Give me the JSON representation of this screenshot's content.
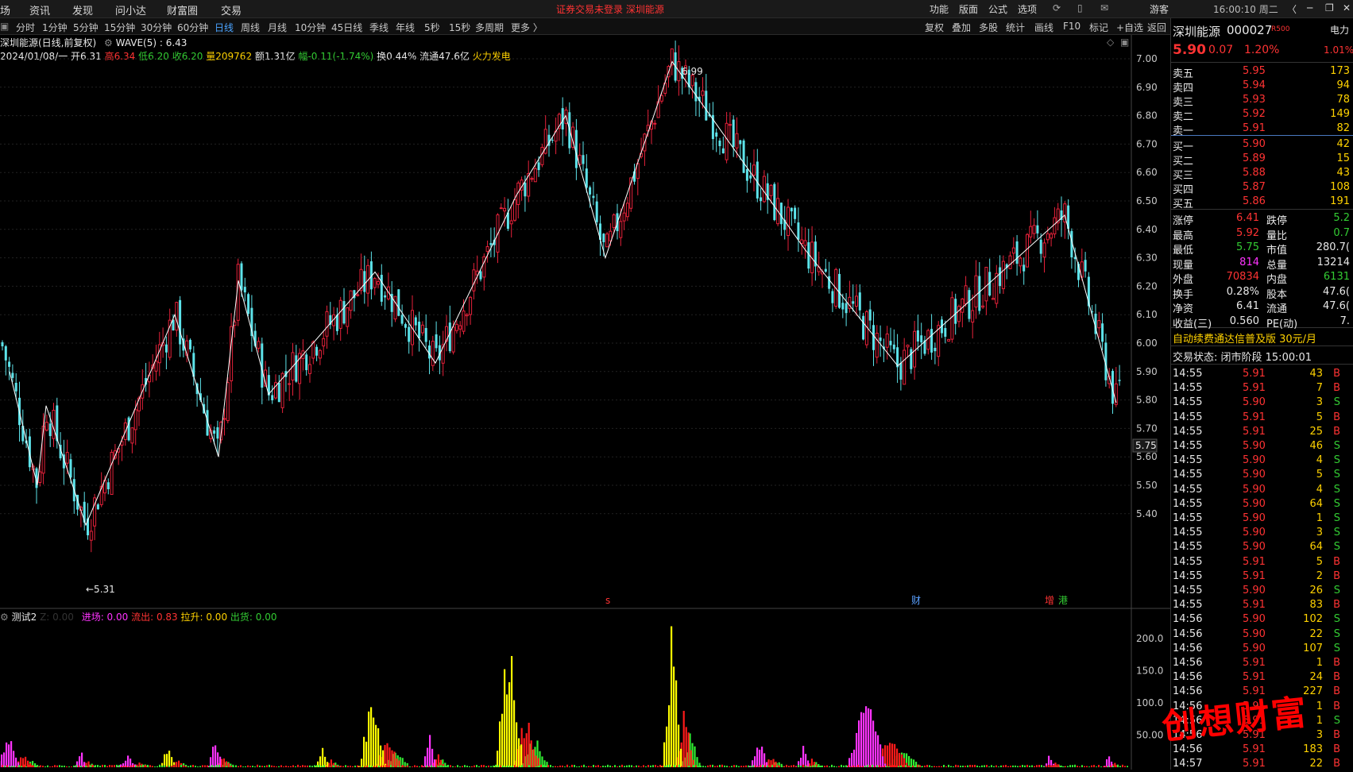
{
  "top_menu": {
    "items": [
      "场",
      "资讯",
      "发现",
      "问小达",
      "财富圈",
      "交易"
    ],
    "notice": "证券交易未登录   深圳能源",
    "right_items": [
      "功能",
      "版面",
      "公式",
      "选项"
    ],
    "guest": "游客",
    "clock": "16:00:10 周二"
  },
  "toolbar": {
    "periods": [
      "分时",
      "1分钟",
      "5分钟",
      "15分钟",
      "30分钟",
      "60分钟",
      "日线",
      "周线",
      "月线",
      "10分钟",
      "45日线",
      "季线",
      "年线",
      "5秒",
      "15秒",
      "多周期",
      "更多 〉"
    ],
    "active": "日线",
    "right_items": [
      "复权",
      "叠加",
      "多股",
      "统计",
      "画线",
      "F10",
      "标记",
      "+自选",
      "返回"
    ]
  },
  "chart_info": {
    "title": "深圳能源(日线,前复权)",
    "indicator": "WAVE(5) : 6.43",
    "date_open": "2024/01/08/一 开6.31",
    "high": "高6.34",
    "low": "低6.20",
    "close": "收6.20",
    "volume": "量209762",
    "amount": "额1.31亿",
    "change": "幅-0.11(-1.74%)",
    "turnover": "换0.44%",
    "float_value": "流通47.6亿",
    "sector": "火力发电",
    "high_mark": "6.99",
    "low_mark": "←5.31",
    "price_tag": "5.75",
    "event_marks": [
      "s",
      "财",
      "增",
      "港"
    ]
  },
  "y_axis": [
    "7.00",
    "6.90",
    "6.80",
    "6.70",
    "6.60",
    "6.50",
    "6.40",
    "6.30",
    "6.20",
    "6.10",
    "6.00",
    "5.90",
    "5.80",
    "5.70",
    "5.60",
    "5.50",
    "5.40"
  ],
  "sub_indicator": {
    "name": "测试2",
    "z": "Z: 0.00",
    "enter": "进场: 0.00",
    "outflow": "流出: 0.83",
    "lift": "拉升: 0.00",
    "ship": "出货: 0.00",
    "y_axis": [
      "200.0",
      "150.0",
      "100.0",
      "50.00"
    ]
  },
  "quote": {
    "name": "深圳能源",
    "code": "000027",
    "badge": "R500",
    "sector_tag": "电力",
    "price": "5.90",
    "change": "0.07",
    "pct": "1.20%",
    "sector_pct": "1.01%",
    "asks": [
      {
        "label": "卖五",
        "price": "5.95",
        "vol": "173"
      },
      {
        "label": "卖四",
        "price": "5.94",
        "vol": "94"
      },
      {
        "label": "卖三",
        "price": "5.93",
        "vol": "78"
      },
      {
        "label": "卖二",
        "price": "5.92",
        "vol": "149"
      },
      {
        "label": "卖一",
        "price": "5.91",
        "vol": "82"
      }
    ],
    "bids": [
      {
        "label": "买一",
        "price": "5.90",
        "vol": "42"
      },
      {
        "label": "买二",
        "price": "5.89",
        "vol": "15"
      },
      {
        "label": "买三",
        "price": "5.88",
        "vol": "43"
      },
      {
        "label": "买四",
        "price": "5.87",
        "vol": "108"
      },
      {
        "label": "买五",
        "price": "5.86",
        "vol": "191"
      }
    ],
    "stats": [
      {
        "l1": "涨停",
        "v1": "6.41",
        "c1": "red",
        "l2": "跌停",
        "v2": "5.2",
        "c2": "green"
      },
      {
        "l1": "最高",
        "v1": "5.92",
        "c1": "red",
        "l2": "量比",
        "v2": "0.7",
        "c2": "green"
      },
      {
        "l1": "最低",
        "v1": "5.75",
        "c1": "green",
        "l2": "市值",
        "v2": "280.7(",
        "c2": "white"
      },
      {
        "l1": "现量",
        "v1": "814",
        "c1": "magenta",
        "l2": "总量",
        "v2": "13214",
        "c2": "white"
      },
      {
        "l1": "外盘",
        "v1": "70834",
        "c1": "red",
        "l2": "内盘",
        "v2": "6131",
        "c2": "green"
      },
      {
        "l1": "换手",
        "v1": "0.28%",
        "c1": "white",
        "l2": "股本",
        "v2": "47.6(",
        "c2": "white"
      },
      {
        "l1": "净资",
        "v1": "6.41",
        "c1": "white",
        "l2": "流通",
        "v2": "47.6(",
        "c2": "white"
      },
      {
        "l1": "收益(三)",
        "v1": "0.560",
        "c1": "white",
        "l2": "PE(动)",
        "v2": "7.",
        "c2": "white"
      }
    ],
    "promo": "自动续费通达信普及版   30元/月",
    "trade_status": "交易状态: 闭市阶段 15:00:01",
    "ticks": [
      [
        "14:55",
        "5.91",
        "43",
        "B"
      ],
      [
        "14:55",
        "5.91",
        "7",
        "B"
      ],
      [
        "14:55",
        "5.90",
        "3",
        "S"
      ],
      [
        "14:55",
        "5.91",
        "5",
        "B"
      ],
      [
        "14:55",
        "5.91",
        "25",
        "B"
      ],
      [
        "14:55",
        "5.90",
        "46",
        "S"
      ],
      [
        "14:55",
        "5.90",
        "4",
        "S"
      ],
      [
        "14:55",
        "5.90",
        "5",
        "S"
      ],
      [
        "14:55",
        "5.90",
        "4",
        "S"
      ],
      [
        "14:55",
        "5.90",
        "64",
        "S"
      ],
      [
        "14:55",
        "5.90",
        "1",
        "S"
      ],
      [
        "14:55",
        "5.90",
        "3",
        "S"
      ],
      [
        "14:55",
        "5.90",
        "64",
        "S"
      ],
      [
        "14:55",
        "5.91",
        "5",
        "B"
      ],
      [
        "14:55",
        "5.91",
        "2",
        "B"
      ],
      [
        "14:55",
        "5.90",
        "26",
        "S"
      ],
      [
        "14:55",
        "5.91",
        "83",
        "B"
      ],
      [
        "14:56",
        "5.90",
        "102",
        "S"
      ],
      [
        "14:56",
        "5.90",
        "22",
        "S"
      ],
      [
        "14:56",
        "5.90",
        "107",
        "S"
      ],
      [
        "14:56",
        "5.91",
        "1",
        "B"
      ],
      [
        "14:56",
        "5.91",
        "24",
        "B"
      ],
      [
        "14:56",
        "5.91",
        "227",
        "B"
      ],
      [
        "14:56",
        "5.91",
        "1",
        "B"
      ],
      [
        "14:56",
        "5.91",
        "1",
        "S"
      ],
      [
        "14:56",
        "5.91",
        "3",
        "B"
      ],
      [
        "14:56",
        "5.91",
        "183",
        "B"
      ],
      [
        "14:57",
        "5.91",
        "22",
        "B"
      ]
    ]
  },
  "watermark": "创想财富",
  "colors": {
    "up": "#e6213a",
    "down": "#5de3ea",
    "wave": "#ffffff",
    "bg": "#000000"
  }
}
